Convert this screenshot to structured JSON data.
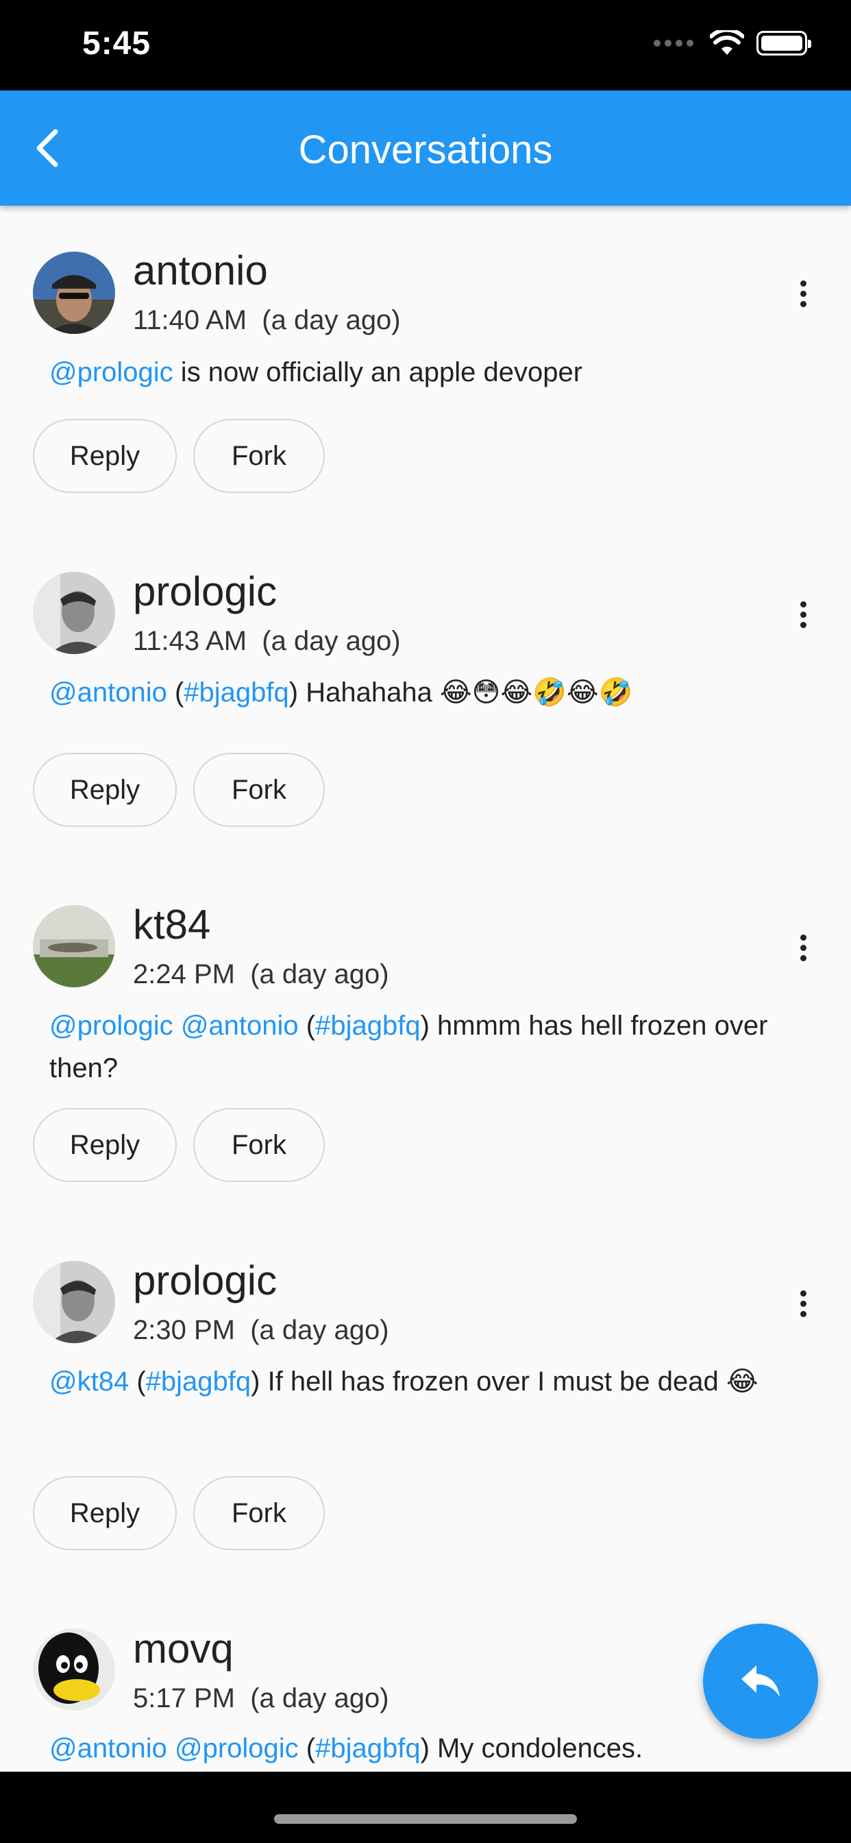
{
  "status_bar": {
    "time": "5:45"
  },
  "app_bar": {
    "title": "Conversations"
  },
  "posts": [
    {
      "username": "antonio",
      "time": "11:40 AM",
      "relative": "(a day ago)",
      "body": [
        {
          "t": "mention",
          "v": "@prologic"
        },
        {
          "t": "text",
          "v": " is now officially an apple devoper"
        }
      ],
      "reply_label": "Reply",
      "fork_label": "Fork",
      "avatar": "antonio-photo"
    },
    {
      "username": "prologic",
      "time": "11:43 AM",
      "relative": "(a day ago)",
      "body": [
        {
          "t": "mention",
          "v": "@antonio"
        },
        {
          "t": "text",
          "v": " ("
        },
        {
          "t": "hashtag",
          "v": "#bjagbfq"
        },
        {
          "t": "text",
          "v": ") Hahahaha 😂😳😂🤣😂🤣"
        }
      ],
      "reply_label": "Reply",
      "fork_label": "Fork",
      "avatar": "prologic-photo"
    },
    {
      "username": "kt84",
      "time": "2:24 PM",
      "relative": "(a day ago)",
      "body": [
        {
          "t": "mention",
          "v": "@prologic"
        },
        {
          "t": "text",
          "v": " "
        },
        {
          "t": "mention",
          "v": "@antonio"
        },
        {
          "t": "text",
          "v": " ("
        },
        {
          "t": "hashtag",
          "v": "#bjagbfq"
        },
        {
          "t": "text",
          "v": ") hmmm has hell frozen over then?"
        }
      ],
      "reply_label": "Reply",
      "fork_label": "Fork",
      "avatar": "kt84-photo"
    },
    {
      "username": "prologic",
      "time": "2:30 PM",
      "relative": "(a day ago)",
      "body": [
        {
          "t": "mention",
          "v": "@kt84"
        },
        {
          "t": "text",
          "v": " ("
        },
        {
          "t": "hashtag",
          "v": "#bjagbfq"
        },
        {
          "t": "text",
          "v": ") If hell has frozen over I must be dead 😂"
        }
      ],
      "reply_label": "Reply",
      "fork_label": "Fork",
      "avatar": "prologic-photo"
    },
    {
      "username": "movq",
      "time": "5:17 PM",
      "relative": "(a day ago)",
      "body": [
        {
          "t": "mention",
          "v": "@antonio"
        },
        {
          "t": "text",
          "v": " "
        },
        {
          "t": "mention",
          "v": "@prologic"
        },
        {
          "t": "text",
          "v": " ("
        },
        {
          "t": "hashtag",
          "v": "#bjagbfq"
        },
        {
          "t": "text",
          "v": ") My condolences."
        }
      ],
      "avatar": "tux-penguin"
    }
  ],
  "icons": {
    "back": "chevron-left-icon",
    "more": "more-vert-icon",
    "fab": "reply-icon",
    "wifi": "wifi-icon",
    "battery": "battery-icon"
  },
  "colors": {
    "accent": "#2196F3",
    "background": "#fafafa",
    "text": "#222222"
  }
}
